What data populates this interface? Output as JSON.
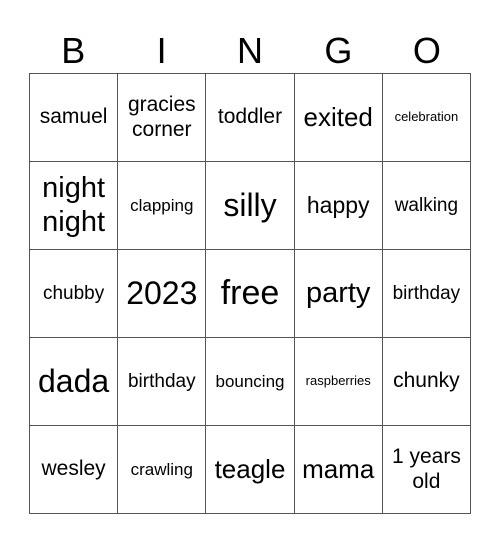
{
  "header": [
    "B",
    "I",
    "N",
    "G",
    "O"
  ],
  "cells": [
    [
      "samuel",
      "gracies corner",
      "toddler",
      "exited",
      "celebration"
    ],
    [
      "night night",
      "clapping",
      "silly",
      "happy",
      "walking"
    ],
    [
      "chubby",
      "2023",
      "free",
      "party",
      "birthday"
    ],
    [
      "dada",
      "birthday",
      "bouncing",
      "raspberries",
      "chunky"
    ],
    [
      "wesley",
      "crawling",
      "teagle",
      "mama",
      "1 years old"
    ]
  ]
}
